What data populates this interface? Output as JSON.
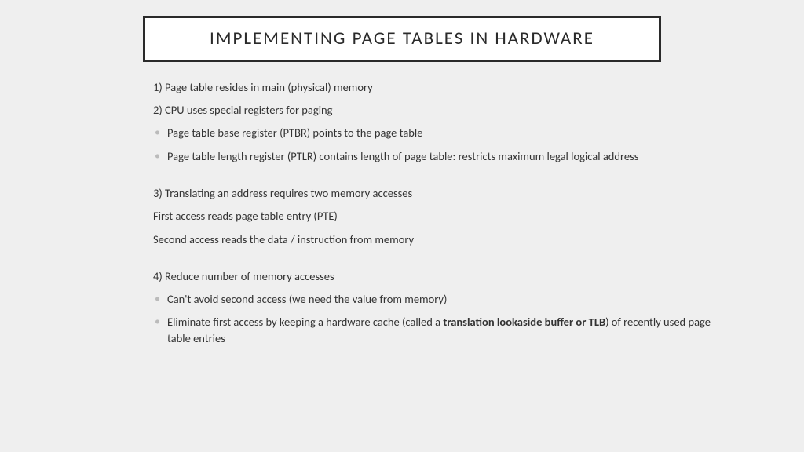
{
  "title": "IMPLEMENTING PAGE TABLES IN HARDWARE",
  "lines": {
    "p1": "1) Page table resides in main (physical) memory",
    "p2": "2) CPU uses special registers for paging",
    "p2a": "Page table base register (PTBR) points to the page table",
    "p2b": "Page table length register (PTLR) contains length of page table: restricts maximum legal logical address",
    "p3": "3) Translating an address requires two memory accesses",
    "p3a": "First access reads page table entry (PTE)",
    "p3b": "Second access reads the data / instruction from memory",
    "p4": "4) Reduce number of memory accesses",
    "p4a": "Can't avoid second access (we need the value from memory)",
    "p4b_pre": "Eliminate first access by keeping a hardware cache (called a ",
    "p4b_bold": "translation lookaside buffer or TLB",
    "p4b_post": ") of recently used page table entries"
  }
}
